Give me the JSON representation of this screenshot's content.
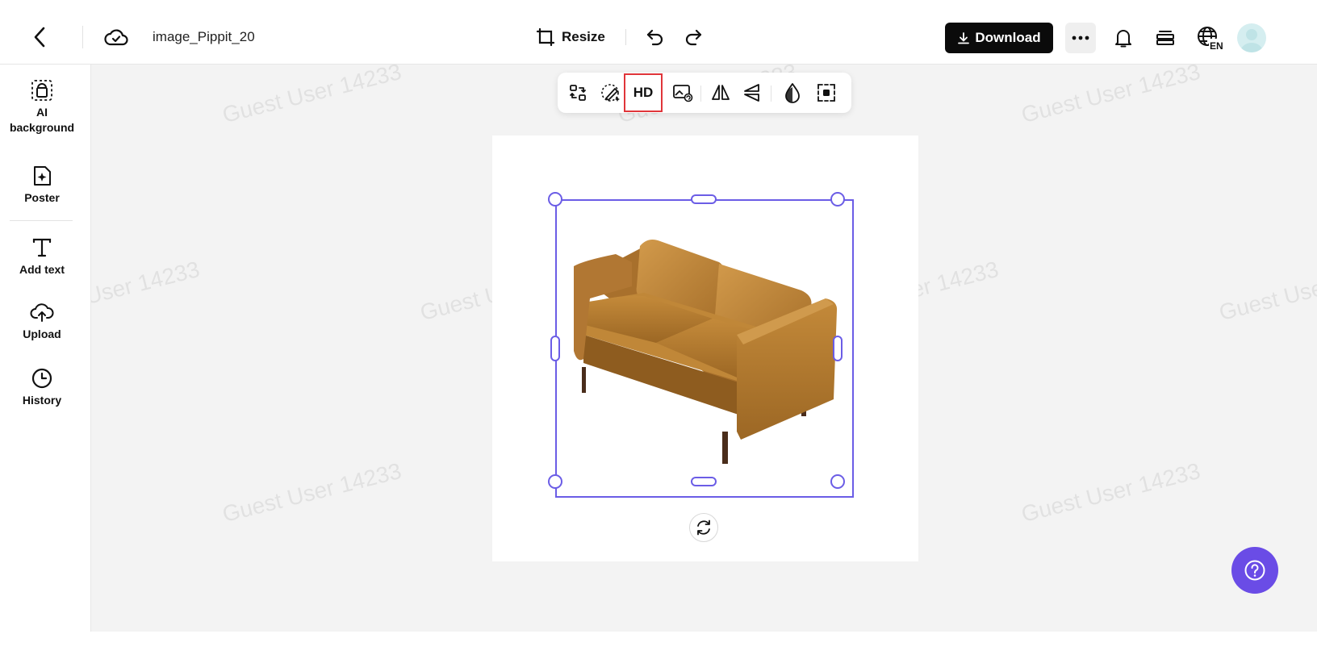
{
  "header": {
    "filename": "image_Pippit_20",
    "resize_label": "Resize",
    "download_label": "Download",
    "language_code": "EN"
  },
  "sidebar": {
    "items": [
      {
        "label": "AI background",
        "icon": "ai-background-icon"
      },
      {
        "label": "Poster",
        "icon": "poster-icon"
      },
      {
        "label": "Add text",
        "icon": "text-icon"
      },
      {
        "label": "Upload",
        "icon": "upload-cloud-icon"
      },
      {
        "label": "History",
        "icon": "clock-icon"
      }
    ]
  },
  "toolbar": {
    "hd_label": "HD",
    "tools": [
      "replace-icon",
      "retouch-icon",
      "hd-upscale",
      "image-edit-icon",
      "flip-horizontal-icon",
      "flip-vertical-icon",
      "opacity-icon",
      "crop-icon"
    ]
  },
  "watermark": "Guest User 14233",
  "colors": {
    "accent": "#6b5de6",
    "help_button": "#6a4ce6",
    "download_bg": "#0b0b0b",
    "highlight": "#e0353a",
    "canvas_bg": "#f3f3f3"
  }
}
